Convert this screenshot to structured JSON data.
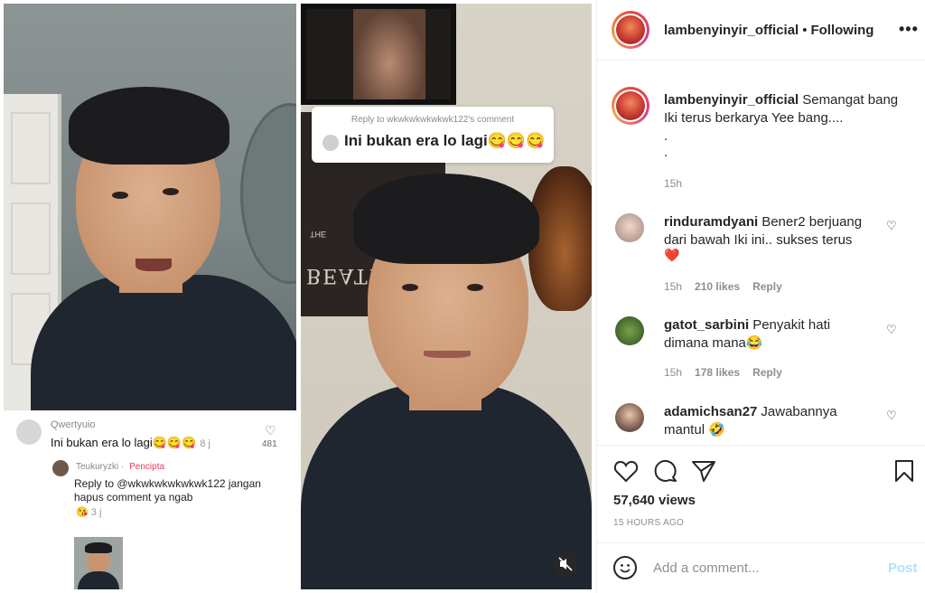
{
  "tiktok_left": {
    "comment_user": "Qwertyuio",
    "comment_text": "Ini bukan era lo lagi😋😋😋",
    "comment_time": "8 j",
    "comment_likes": "481",
    "reply_user": "Teukuryzki",
    "reply_badge": "Pencipta",
    "reply_text": "Reply to @wkwkwkwkwkwk122 jangan hapus comment ya ngab",
    "reply_emoji": "😘",
    "reply_time": "3 j"
  },
  "tiktok_right": {
    "reply_header": "Reply to wkwkwkwkwkwk122's comment",
    "reply_text": "Ini bukan era lo lagi😋😋😋",
    "poster_text": "BEATLES",
    "poster_small": "THE"
  },
  "post": {
    "username": "lambenyinyir_official",
    "follow_status": "Following",
    "caption": "Semangat bang Iki terus berkarya Yee bang....",
    "caption_dot_1": ".",
    "caption_dot_2": ".",
    "caption_time": "15h",
    "comments": [
      {
        "user": "rinduramdyani",
        "text": "Bener2 berjuang dari bawah Iki ini.. sukses terus",
        "emoji": "❤️",
        "time": "15h",
        "likes": "210 likes",
        "reply": "Reply"
      },
      {
        "user": "gatot_sarbini",
        "text": "Penyakit hati dimana mana😂",
        "time": "15h",
        "likes": "178 likes",
        "reply": "Reply"
      },
      {
        "user": "adamichsan27",
        "text": "Jawabannya mantul 🤣"
      }
    ],
    "views": "57,640 views",
    "time_ago": "15 HOURS AGO",
    "add_comment_placeholder": "Add a comment...",
    "post_label": "Post"
  },
  "icons": [
    "heart-icon",
    "comment-icon",
    "share-icon",
    "bookmark-icon",
    "emoji-icon",
    "more-icon",
    "mute-icon"
  ],
  "colors": {
    "post_button": "#b2dffc",
    "tiktok_creator": "#e8395d",
    "meta_gray": "#8e8e8e"
  }
}
